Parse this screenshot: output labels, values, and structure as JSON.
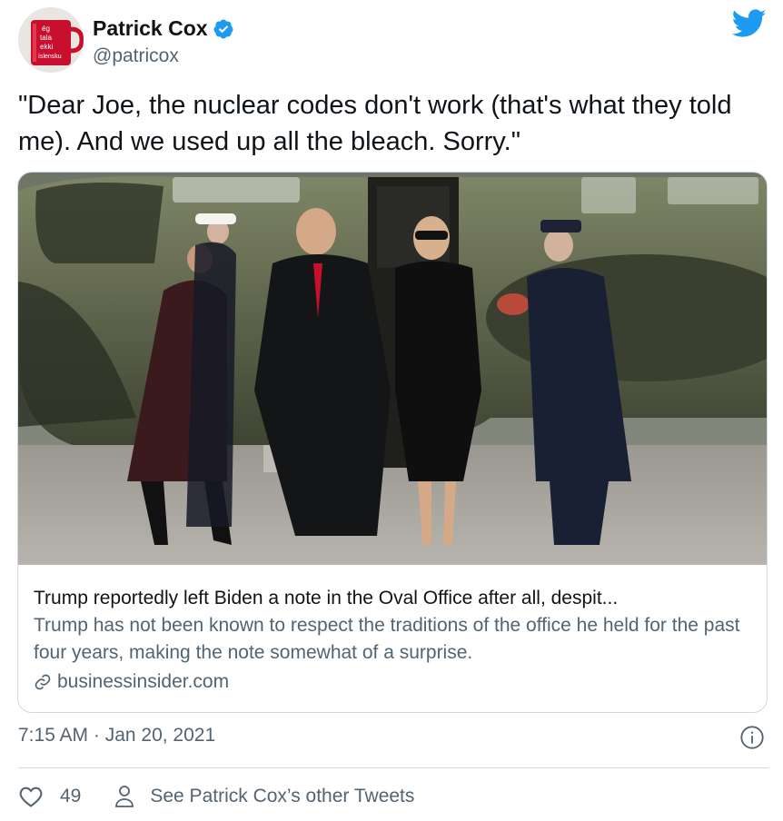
{
  "user": {
    "display_name": "Patrick Cox",
    "handle": "@patricox",
    "avatar_mug_text": [
      "ég",
      "tala",
      "ekki",
      "íslensku"
    ]
  },
  "tweet": {
    "text": "\"Dear Joe, the nuclear codes don't work (that's what they told me). And we used up all the bleach. Sorry.\"",
    "timestamp": "7:15 AM · Jan 20, 2021"
  },
  "card": {
    "title": "Trump reportedly left Biden a note in the Oval Office after all, despit...",
    "description": "Trump has not been known to respect the traditions of the office he held for the past four years, making the note somewhat of a surprise.",
    "domain": "businessinsider.com"
  },
  "actions": {
    "like_count": "49",
    "other_tweets_label": "See Patrick Cox’s other Tweets"
  },
  "colors": {
    "twitter_blue": "#1d9bf0",
    "secondary_text": "#536471",
    "border": "#cfd9de"
  },
  "icons": [
    "verified-badge-icon",
    "twitter-bird-icon",
    "link-icon",
    "info-icon",
    "heart-icon",
    "person-icon"
  ]
}
